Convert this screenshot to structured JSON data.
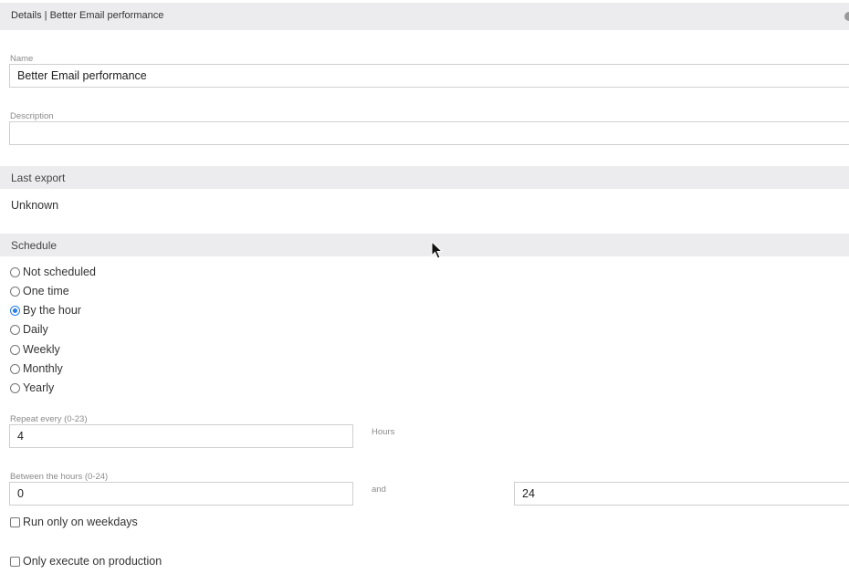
{
  "header": {
    "title": "Details | Better Email performance"
  },
  "name_field": {
    "label": "Name",
    "value": "Better Email performance"
  },
  "description_field": {
    "label": "Description",
    "value": ""
  },
  "last_export": {
    "title": "Last export",
    "value": "Unknown"
  },
  "schedule": {
    "title": "Schedule",
    "options": [
      {
        "label": "Not scheduled",
        "selected": false
      },
      {
        "label": "One time",
        "selected": false
      },
      {
        "label": "By the hour",
        "selected": true
      },
      {
        "label": "Daily",
        "selected": false
      },
      {
        "label": "Weekly",
        "selected": false
      },
      {
        "label": "Monthly",
        "selected": false
      },
      {
        "label": "Yearly",
        "selected": false
      }
    ],
    "repeat_label": "Repeat every (0-23)",
    "repeat_value": "4",
    "repeat_unit": "Hours",
    "between_label": "Between the hours (0-24)",
    "between_from": "0",
    "and_label": "and",
    "between_to": "24",
    "weekdays_label": "Run only on weekdays",
    "weekdays_checked": false,
    "production_label": "Only execute on production",
    "production_checked": false
  },
  "colors": {
    "section_bg": "#ececef",
    "radio_accent": "#2b7de9"
  }
}
